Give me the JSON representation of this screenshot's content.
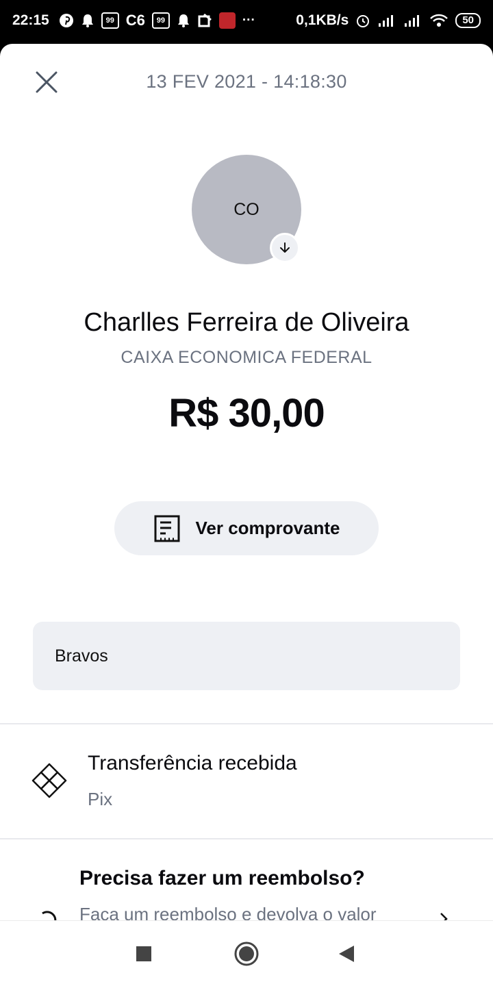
{
  "status_bar": {
    "time": "22:15",
    "icon_c6": "C6",
    "icon_99_a": "99\nFood",
    "icon_99_b": "99\nFood",
    "network_speed": "0,1KB/s",
    "battery": "50"
  },
  "header": {
    "date": "13 FEV 2021 - 14:18:30"
  },
  "contact": {
    "initials": "CO",
    "name": "Charlles Ferreira de Oliveira",
    "bank": "CAIXA ECONOMICA FEDERAL"
  },
  "amount": "R$ 30,00",
  "receipt_button": {
    "label": "Ver comprovante"
  },
  "message": "Bravos",
  "transaction": {
    "title": "Transferência recebida",
    "method": "Pix"
  },
  "refund": {
    "title": "Precisa fazer um reembolso?",
    "description": "Faça um reembolso e devolva o valor"
  },
  "colors": {
    "avatar": "#b8bac3",
    "surface": "#eef0f4",
    "muted_text": "#6b7280"
  }
}
